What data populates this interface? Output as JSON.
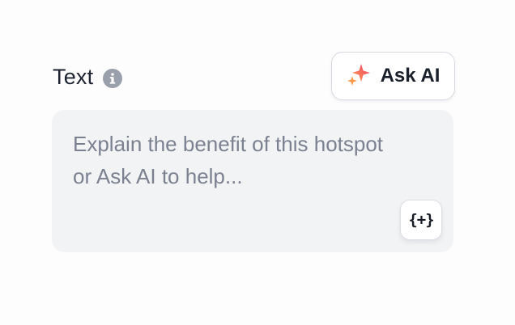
{
  "field": {
    "label": "Text",
    "info_icon": "info-icon"
  },
  "ask_ai": {
    "label": "Ask AI",
    "icon": "sparkle-icon",
    "icon_colors": [
      "#f0436d",
      "#f99a4b"
    ]
  },
  "textarea": {
    "value": "",
    "placeholder": "Explain the benefit of this hotspot or Ask AI to help..."
  },
  "insert_variable": {
    "label": "{+}"
  },
  "colors": {
    "text": "#1d2330",
    "placeholder": "#7b8190",
    "field_bg": "#f2f3f5",
    "info_icon": "#9aa0ab"
  }
}
